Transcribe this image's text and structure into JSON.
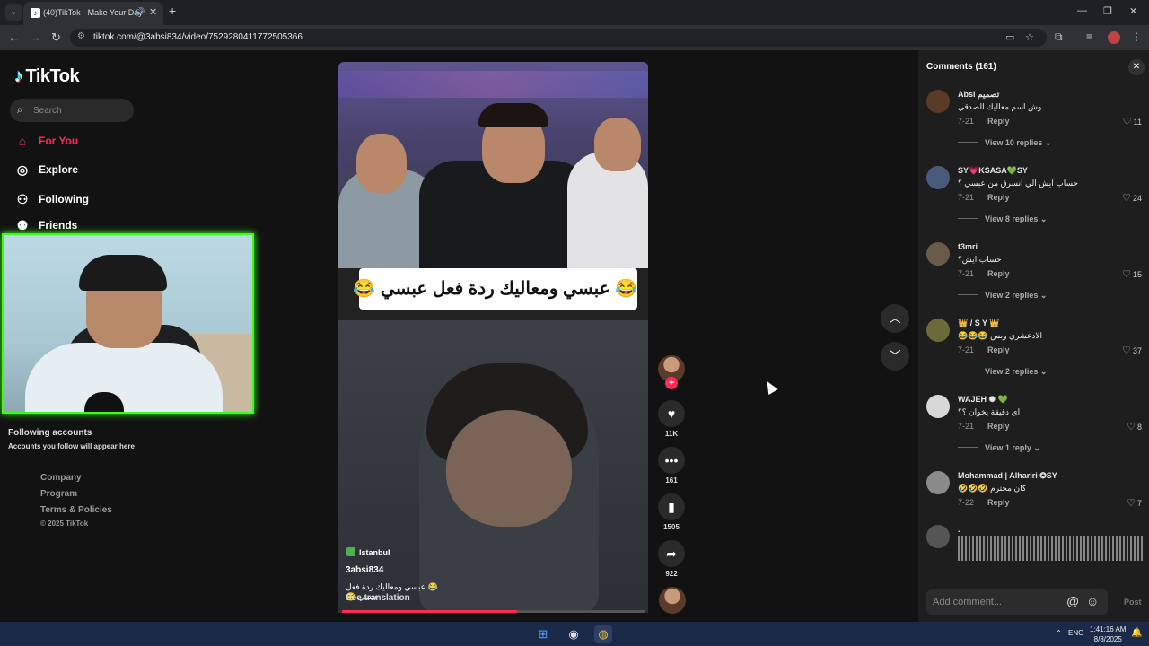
{
  "browser": {
    "tab_title": "(40)TikTok - Make Your Day",
    "url": "tiktok.com/@3absi834/video/7529280411772505366"
  },
  "sidebar": {
    "logo_text": "TikTok",
    "search_placeholder": "Search",
    "nav": [
      {
        "label": "For You",
        "icon": "home-icon"
      },
      {
        "label": "Explore",
        "icon": "compass-icon"
      },
      {
        "label": "Following",
        "icon": "following-icon"
      },
      {
        "label": "Friends",
        "icon": "friends-icon"
      }
    ],
    "following_title": "Following accounts",
    "following_sub": "Accounts you follow will appear here",
    "links": [
      "Company",
      "Program",
      "Terms & Policies"
    ],
    "copyright": "© 2025 TikTok"
  },
  "video": {
    "caption_overlay": "😂 عبسي ومعاليك ردة فعل عبسي 😂",
    "location": "Istanbul",
    "author": "3absi834",
    "description": "😂 عبسي ومعاليك ردة فعل عبسي 😂",
    "see_translation": "See translation",
    "progress": 0.58
  },
  "actions": {
    "likes": "11K",
    "comments": "161",
    "saves": "1505",
    "shares": "922"
  },
  "comments_panel": {
    "title": "Comments (161)",
    "add_placeholder": "Add comment...",
    "post_label": "Post",
    "items": [
      {
        "user": "Absi تصميم",
        "text": "وش اسم معاليك الصدقي",
        "date": "7-21",
        "reply": "Reply",
        "likes": "11",
        "view_replies": "View 10 replies",
        "avatar_color": "#5a3b2a"
      },
      {
        "user": "SY💗KSASA💚SY",
        "text": "حساب ايش الي انسرق من عبسي ؟",
        "date": "7-21",
        "reply": "Reply",
        "likes": "24",
        "view_replies": "View 8 replies",
        "avatar_color": "#4a5a7a"
      },
      {
        "user": "t3mri",
        "text": "حساب ايش؟",
        "date": "7-21",
        "reply": "Reply",
        "likes": "15",
        "view_replies": "View 2 replies",
        "avatar_color": "#6a5a4a"
      },
      {
        "user": "👑 / S Y 👑",
        "text": "الادعشري وبس 😂😂😂",
        "date": "7-21",
        "reply": "Reply",
        "likes": "37",
        "view_replies": "View 2 replies",
        "avatar_color": "#6a6a3a"
      },
      {
        "user": "WAJEH ✺ 💚",
        "text": "اي دقيقة يخوان ؟؟",
        "date": "7-21",
        "reply": "Reply",
        "likes": "8",
        "view_replies": "View 1 reply",
        "avatar_color": "#d8d8d8"
      },
      {
        "user": "Mohammad | Alhariri ✪SY",
        "text": "كان محترم 🤣🤣🤣",
        "date": "7-22",
        "reply": "Reply",
        "likes": "7",
        "view_replies": "",
        "avatar_color": "#8a8a8a"
      },
      {
        "user": ".",
        "text": "",
        "date": "",
        "reply": "",
        "likes": "",
        "view_replies": "",
        "avatar_color": "#555555"
      }
    ]
  },
  "taskbar": {
    "lang": "ENG",
    "time": "1:41:16 AM",
    "date": "8/8/2025"
  },
  "colors": {
    "accent": "#fe2c55",
    "webcam_border": "#39ff14"
  }
}
